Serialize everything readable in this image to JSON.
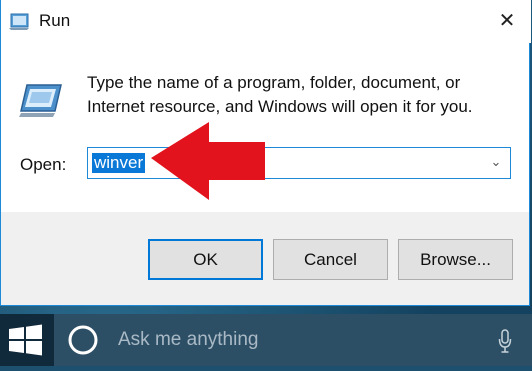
{
  "dialog": {
    "title": "Run",
    "close_glyph": "✕",
    "description": "Type the name of a program, folder, document, or Internet resource, and Windows will open it for you.",
    "open_label": "Open:",
    "open_value": "winver",
    "dropdown_glyph": "⌄",
    "buttons": {
      "ok": "OK",
      "cancel": "Cancel",
      "browse": "Browse..."
    },
    "icons": {
      "title": "run-icon",
      "content": "run-icon",
      "annotation": "red-arrow-icon"
    },
    "colors": {
      "accent": "#0078d7",
      "selection": "#0a78d7",
      "arrow": "#e2131c"
    }
  },
  "taskbar": {
    "search_placeholder": "Ask me anything",
    "icons": {
      "start": "windows-logo-icon",
      "cortana": "cortana-circle-icon",
      "mic": "microphone-icon"
    },
    "colors": {
      "taskbar": "#10293b",
      "search_box": "#2d4f66"
    }
  }
}
